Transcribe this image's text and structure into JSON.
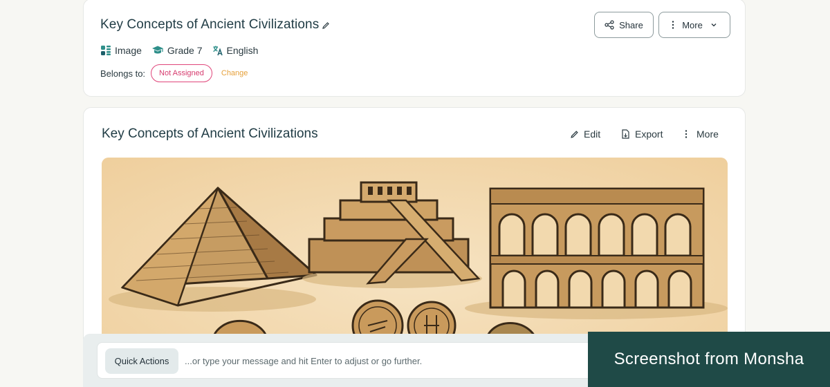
{
  "header": {
    "title": "Key Concepts of Ancient Civilizations",
    "meta": [
      {
        "icon": "image-type-icon",
        "label": "Image"
      },
      {
        "icon": "graduation-cap-icon",
        "label": "Grade 7"
      },
      {
        "icon": "translate-icon",
        "label": "English"
      }
    ],
    "belongs_label": "Belongs to:",
    "assignment_status": "Not Assigned",
    "change_label": "Change",
    "share_label": "Share",
    "more_label": "More"
  },
  "content": {
    "title": "Key Concepts of Ancient Civilizations",
    "edit_label": "Edit",
    "export_label": "Export",
    "more_label": "More",
    "illustration_icons": [
      "pyramid-drawing",
      "ziggurat-drawing",
      "aqueduct-drawing",
      "coin-drawing"
    ]
  },
  "chat": {
    "quick_actions_label": "Quick Actions",
    "placeholder": "...or type your message and hit Enter to adjust or go further."
  },
  "watermark": "Screenshot from Monsha",
  "colors": {
    "accent_teal": "#1f4a47",
    "pill_pink": "#d63b6e",
    "change_orange": "#e6a03a",
    "sepia_bg": "#f3dcb6"
  }
}
